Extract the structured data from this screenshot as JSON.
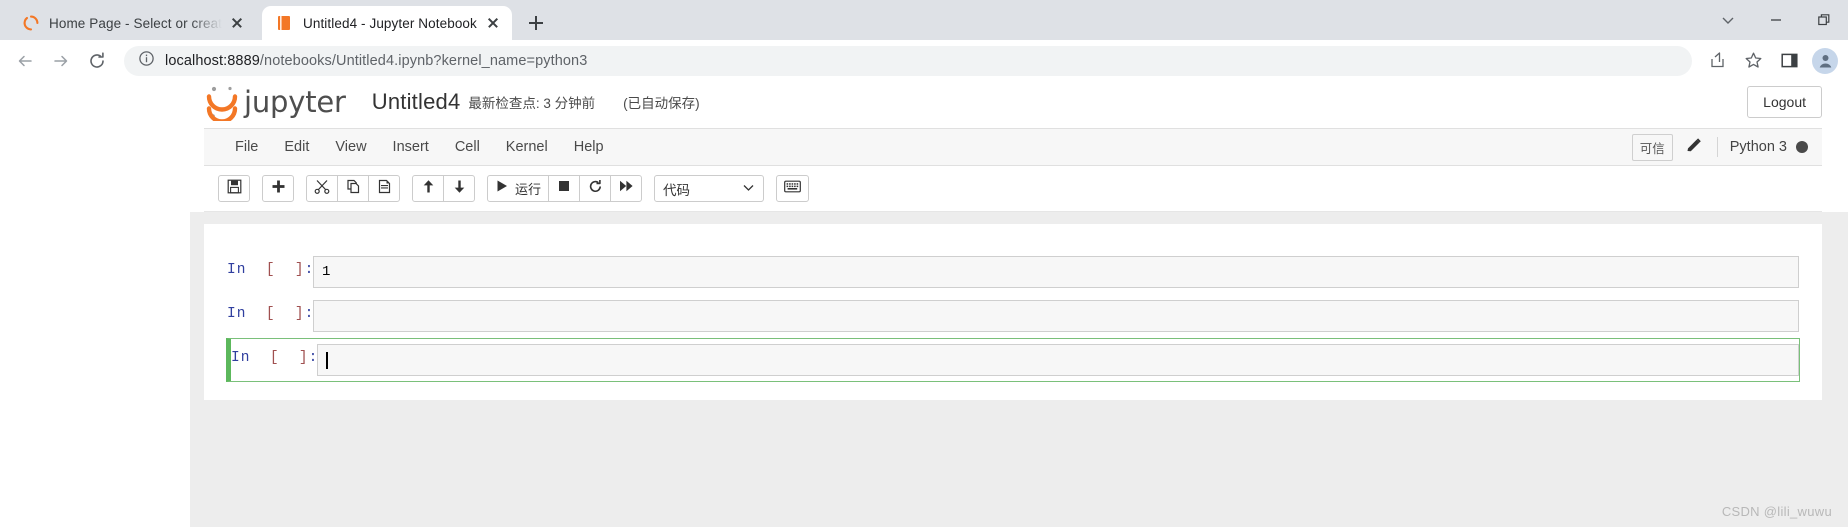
{
  "browser": {
    "tabs": [
      {
        "title": "Home Page - Select or create a",
        "favicon": "jupyter-loading-icon",
        "active": false
      },
      {
        "title": "Untitled4 - Jupyter Notebook",
        "favicon": "jupyter-notebook-icon",
        "active": true
      }
    ],
    "new_tab_label": "+",
    "window_controls": [
      "chevron-down-icon",
      "minimize-icon",
      "restore-icon"
    ],
    "nav": {
      "back": "back-arrow-icon",
      "forward": "forward-arrow-icon",
      "reload": "reload-icon"
    },
    "omnibox": {
      "site_info_icon": "info-circle-icon",
      "host": "localhost:8889",
      "path": "/notebooks/Untitled4.ipynb?kernel_name=python3",
      "full_url": "localhost:8889/notebooks/Untitled4.ipynb?kernel_name=python3"
    },
    "toolbar_icons": [
      "share-icon",
      "star-icon",
      "sidepanel-icon",
      "profile-avatar-icon"
    ]
  },
  "notebook": {
    "brand": "jupyter",
    "logo_icon": "jupyter-logo-icon",
    "name": "Untitled4",
    "checkpoint": "最新检查点: 3 分钟前",
    "autosave": "(已自动保存)",
    "logout_label": "Logout",
    "menu": [
      {
        "label": "File"
      },
      {
        "label": "Edit"
      },
      {
        "label": "View"
      },
      {
        "label": "Insert"
      },
      {
        "label": "Cell"
      },
      {
        "label": "Kernel"
      },
      {
        "label": "Help"
      }
    ],
    "trusted_label": "可信",
    "edit_icon": "pencil-icon",
    "kernel_label": "Python 3",
    "kernel_status_icon": "kernel-busy-circle-icon",
    "toolbar": {
      "groups": [
        {
          "buttons": [
            {
              "icon": "save-icon",
              "label": ""
            }
          ]
        },
        {
          "buttons": [
            {
              "icon": "plus-icon",
              "label": ""
            }
          ]
        },
        {
          "buttons": [
            {
              "icon": "scissors-cut-icon",
              "label": ""
            },
            {
              "icon": "copy-icon",
              "label": ""
            },
            {
              "icon": "paste-icon",
              "label": ""
            }
          ]
        },
        {
          "buttons": [
            {
              "icon": "arrow-up-icon",
              "label": ""
            },
            {
              "icon": "arrow-down-icon",
              "label": ""
            }
          ]
        },
        {
          "buttons": [
            {
              "icon": "play-run-icon",
              "label": "运行"
            },
            {
              "icon": "stop-square-icon",
              "label": ""
            },
            {
              "icon": "restart-refresh-icon",
              "label": ""
            },
            {
              "icon": "fast-forward-icon",
              "label": ""
            }
          ]
        }
      ],
      "cell_type": {
        "value": "代码",
        "chevron": "chevron-down-icon"
      },
      "command_palette_icon": "keyboard-icon"
    },
    "cells": [
      {
        "prompt_in": "In",
        "prompt_num": "[  ]:",
        "source": "1",
        "selected": false,
        "cursor": false
      },
      {
        "prompt_in": "In",
        "prompt_num": "[  ]:",
        "source": "",
        "selected": false,
        "cursor": false
      },
      {
        "prompt_in": "In",
        "prompt_num": "[  ]:",
        "source": "",
        "selected": true,
        "cursor": true
      }
    ]
  },
  "watermark": "CSDN @lili_wuwu",
  "colors": {
    "jupyter_orange": "#f37726",
    "selected_cell_green": "#5cb85c",
    "chrome_tabstrip": "#dee1e6",
    "omnibox_bg": "#f1f3f4",
    "canvas_gray": "#ededed"
  }
}
